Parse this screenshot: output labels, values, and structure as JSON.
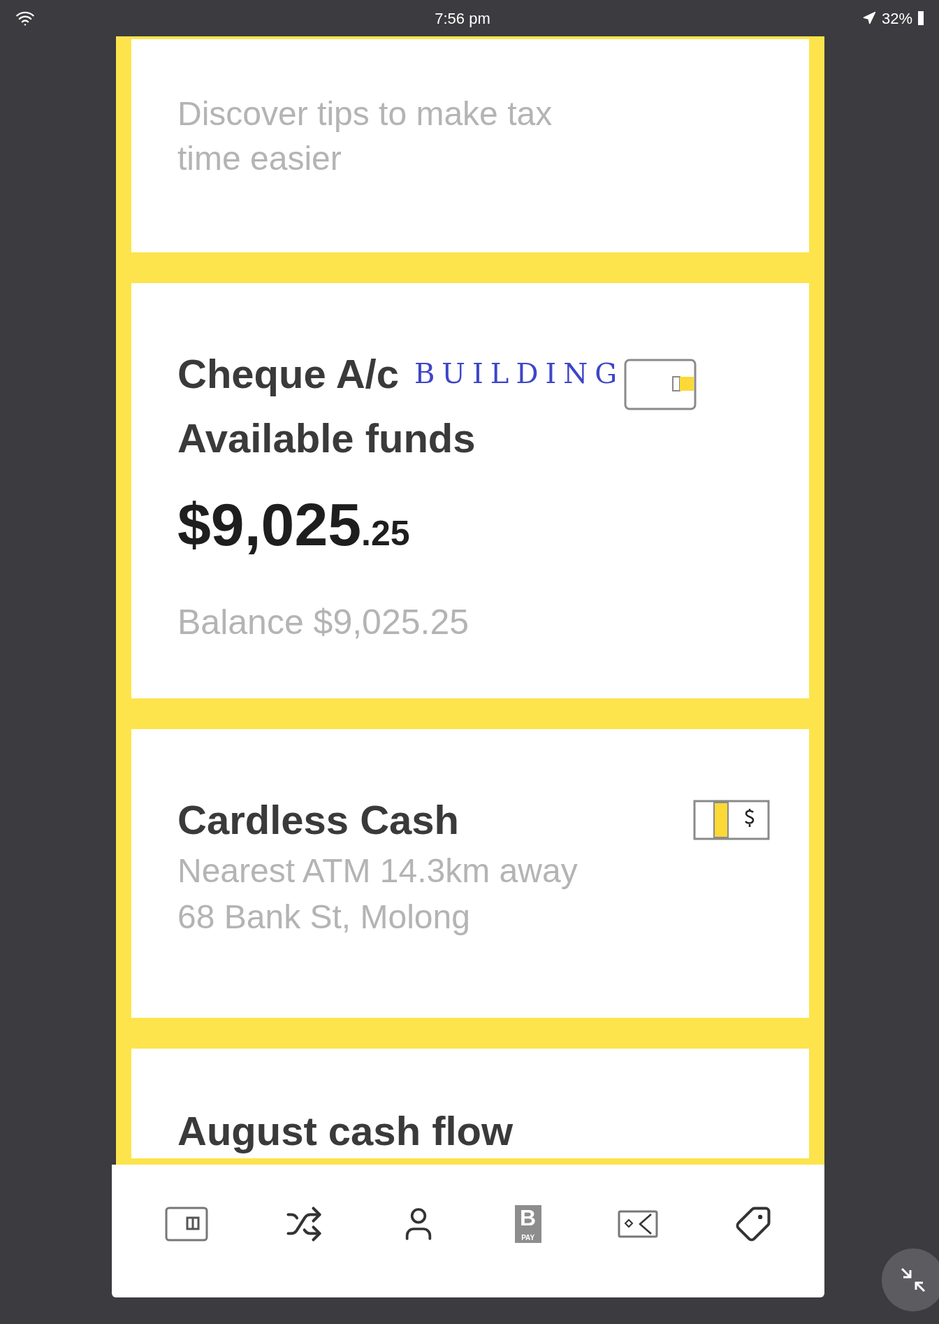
{
  "status_bar": {
    "time": "7:56 pm",
    "battery": "32%"
  },
  "cards": [
    {
      "kind": "tip",
      "text": "Discover tips to make tax time easier"
    },
    {
      "kind": "account",
      "title": "Cheque A/c",
      "annotation": "BUILDING",
      "subtitle": "Available funds",
      "amount": "$9,025",
      "cents": ".25",
      "balance": "Balance $9,025.25"
    },
    {
      "kind": "cardless",
      "title": "Cardless Cash",
      "lines": [
        "Nearest ATM 14.3km away",
        "68 Bank St, Molong"
      ]
    },
    {
      "kind": "heading",
      "title": "August cash flow"
    }
  ],
  "tab_bar": [
    {
      "kind": "card"
    },
    {
      "kind": "shuffle"
    },
    {
      "kind": "person"
    },
    {
      "kind": "bpay",
      "letter": "B",
      "label": "PAY"
    },
    {
      "kind": "transfer"
    },
    {
      "kind": "tag"
    }
  ]
}
